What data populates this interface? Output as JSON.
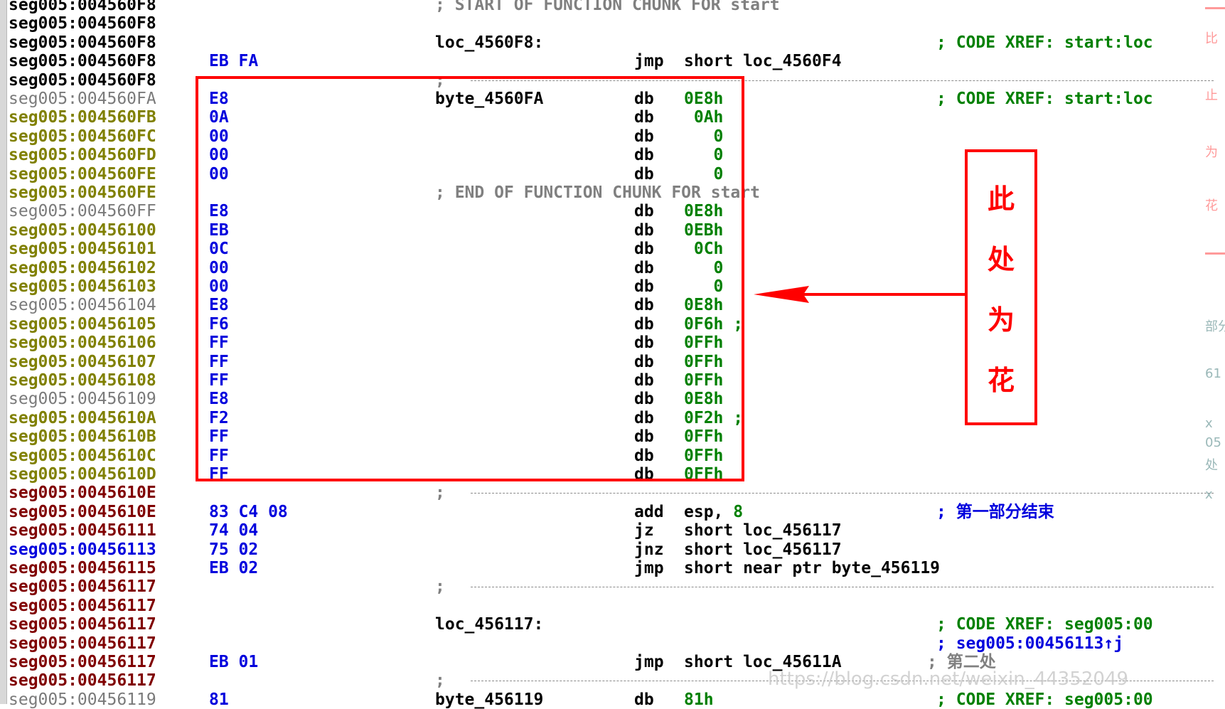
{
  "listing": [
    {
      "addr": "seg005:004560F8",
      "addr_color": "black",
      "kind": "comment",
      "text": "; START OF FUNCTION CHUNK FOR start"
    },
    {
      "addr": "seg005:004560F8",
      "addr_color": "black",
      "kind": "blank"
    },
    {
      "addr": "seg005:004560F8",
      "addr_color": "black",
      "kind": "code",
      "label": "loc_4560F8:",
      "comment": "; CODE XREF: start:loc"
    },
    {
      "addr": "seg005:004560F8",
      "addr_color": "black",
      "kind": "code",
      "bytes": "EB FA",
      "mnem": "jmp",
      "oper": "short loc_4560F4"
    },
    {
      "addr": "seg005:004560F8",
      "addr_color": "black",
      "kind": "separator"
    },
    {
      "addr": "seg005:004560FA",
      "addr_color": "gray",
      "kind": "code",
      "bytes": "E8",
      "label": "byte_4560FA",
      "mnem": "db",
      "oper": "0E8h",
      "oper_color": "green",
      "comment": "; CODE XREF: start:loc"
    },
    {
      "addr": "seg005:004560FB",
      "addr_color": "olive",
      "kind": "code",
      "bytes": "0A",
      "mnem": "db",
      "oper": " 0Ah",
      "oper_color": "green"
    },
    {
      "addr": "seg005:004560FC",
      "addr_color": "olive",
      "kind": "code",
      "bytes": "00",
      "mnem": "db",
      "oper": "   0",
      "oper_color": "green"
    },
    {
      "addr": "seg005:004560FD",
      "addr_color": "olive",
      "kind": "code",
      "bytes": "00",
      "mnem": "db",
      "oper": "   0",
      "oper_color": "green"
    },
    {
      "addr": "seg005:004560FE",
      "addr_color": "olive",
      "kind": "code",
      "bytes": "00",
      "mnem": "db",
      "oper": "   0",
      "oper_color": "green"
    },
    {
      "addr": "seg005:004560FE",
      "addr_color": "olive",
      "kind": "comment",
      "text": "; END OF FUNCTION CHUNK FOR start"
    },
    {
      "addr": "seg005:004560FF",
      "addr_color": "gray",
      "kind": "code",
      "bytes": "E8",
      "mnem": "db",
      "oper": "0E8h",
      "oper_color": "green"
    },
    {
      "addr": "seg005:00456100",
      "addr_color": "olive",
      "kind": "code",
      "bytes": "EB",
      "mnem": "db",
      "oper": "0EBh",
      "oper_color": "green"
    },
    {
      "addr": "seg005:00456101",
      "addr_color": "olive",
      "kind": "code",
      "bytes": "0C",
      "mnem": "db",
      "oper": " 0Ch",
      "oper_color": "green"
    },
    {
      "addr": "seg005:00456102",
      "addr_color": "olive",
      "kind": "code",
      "bytes": "00",
      "mnem": "db",
      "oper": "   0",
      "oper_color": "green"
    },
    {
      "addr": "seg005:00456103",
      "addr_color": "olive",
      "kind": "code",
      "bytes": "00",
      "mnem": "db",
      "oper": "   0",
      "oper_color": "green"
    },
    {
      "addr": "seg005:00456104",
      "addr_color": "gray",
      "kind": "code",
      "bytes": "E8",
      "mnem": "db",
      "oper": "0E8h",
      "oper_color": "green"
    },
    {
      "addr": "seg005:00456105",
      "addr_color": "olive",
      "kind": "code",
      "bytes": "F6",
      "mnem": "db",
      "oper": "0F6h ;",
      "oper_color": "green"
    },
    {
      "addr": "seg005:00456106",
      "addr_color": "olive",
      "kind": "code",
      "bytes": "FF",
      "mnem": "db",
      "oper": "0FFh",
      "oper_color": "green"
    },
    {
      "addr": "seg005:00456107",
      "addr_color": "olive",
      "kind": "code",
      "bytes": "FF",
      "mnem": "db",
      "oper": "0FFh",
      "oper_color": "green"
    },
    {
      "addr": "seg005:00456108",
      "addr_color": "olive",
      "kind": "code",
      "bytes": "FF",
      "mnem": "db",
      "oper": "0FFh",
      "oper_color": "green"
    },
    {
      "addr": "seg005:00456109",
      "addr_color": "gray",
      "kind": "code",
      "bytes": "E8",
      "mnem": "db",
      "oper": "0E8h",
      "oper_color": "green"
    },
    {
      "addr": "seg005:0045610A",
      "addr_color": "olive",
      "kind": "code",
      "bytes": "F2",
      "mnem": "db",
      "oper": "0F2h ;",
      "oper_color": "green"
    },
    {
      "addr": "seg005:0045610B",
      "addr_color": "olive",
      "kind": "code",
      "bytes": "FF",
      "mnem": "db",
      "oper": "0FFh",
      "oper_color": "green"
    },
    {
      "addr": "seg005:0045610C",
      "addr_color": "olive",
      "kind": "code",
      "bytes": "FF",
      "mnem": "db",
      "oper": "0FFh",
      "oper_color": "green"
    },
    {
      "addr": "seg005:0045610D",
      "addr_color": "olive",
      "kind": "code",
      "bytes": "FF",
      "mnem": "db",
      "oper": "0FFh",
      "oper_color": "green"
    },
    {
      "addr": "seg005:0045610E",
      "addr_color": "red",
      "kind": "separator"
    },
    {
      "addr": "seg005:0045610E",
      "addr_color": "red",
      "kind": "code",
      "bytes": "83 C4 08",
      "mnem": "add",
      "oper": "esp, 8",
      "oper_color": "mixed_esp",
      "comment": "; 第一部分结束",
      "comment_color": "blue"
    },
    {
      "addr": "seg005:00456111",
      "addr_color": "red",
      "kind": "code",
      "bytes": "74 04",
      "mnem": "jz",
      "oper": "short loc_456117"
    },
    {
      "addr": "seg005:00456113",
      "addr_color": "blue",
      "kind": "code",
      "bytes": "75 02",
      "mnem": "jnz",
      "oper": "short loc_456117"
    },
    {
      "addr": "seg005:00456115",
      "addr_color": "red",
      "kind": "code",
      "bytes": "EB 02",
      "mnem": "jmp",
      "oper": "short near ptr byte_456119"
    },
    {
      "addr": "seg005:00456117",
      "addr_color": "red",
      "kind": "separator"
    },
    {
      "addr": "seg005:00456117",
      "addr_color": "red",
      "kind": "blank"
    },
    {
      "addr": "seg005:00456117",
      "addr_color": "red",
      "kind": "code",
      "label": "loc_456117:",
      "comment": "; CODE XREF: seg005:00"
    },
    {
      "addr": "seg005:00456117",
      "addr_color": "red",
      "kind": "code",
      "comment": "; seg005:00456113↑j",
      "comment_color": "green_blue"
    },
    {
      "addr": "seg005:00456117",
      "addr_color": "red",
      "kind": "code",
      "bytes": "EB 01",
      "mnem": "jmp",
      "oper": "short loc_45611A",
      "trail": "; 第二处"
    },
    {
      "addr": "seg005:00456117",
      "addr_color": "red",
      "kind": "separator"
    },
    {
      "addr": "seg005:00456119",
      "addr_color": "gray",
      "kind": "code",
      "bytes": "81",
      "label": "byte_456119",
      "mnem": "db",
      "oper": "81h",
      "oper_color": "green",
      "comment": "; CODE XREF: seg005:00"
    }
  ],
  "annotation": {
    "note": [
      "此",
      "处",
      "为",
      "花"
    ],
    "arrow_color": "#ff0000"
  },
  "right_edge_fragments": [
    "比",
    "止",
    "为",
    "花",
    "部分",
    "61",
    "x",
    "05",
    "处",
    "x"
  ],
  "watermark": "https://blog.csdn.net/weixin_44352049",
  "colors": {
    "address_black": "#000000",
    "address_olive": "#808000",
    "address_red": "#800000",
    "address_blue": "#0000dd",
    "address_gray": "#7a7a7a",
    "bytes_blue": "#0000dd",
    "operand_green": "#008000",
    "comment_green": "#008000",
    "annotation_red": "#ff0000"
  }
}
